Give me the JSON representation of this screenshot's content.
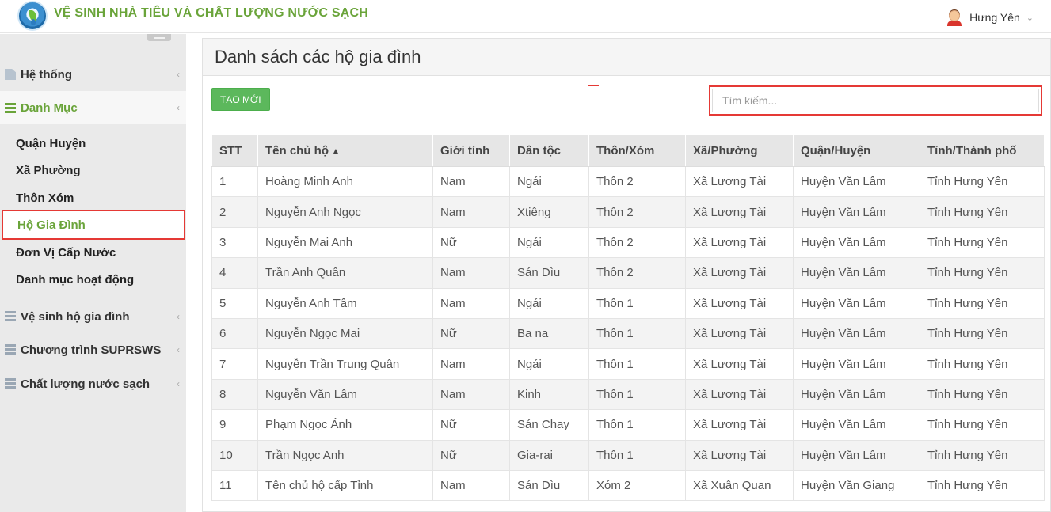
{
  "app": {
    "title": "VỆ SINH NHÀ TIÊU VÀ CHẤT LƯỢNG NƯỚC SẠCH",
    "user": "Hưng Yên"
  },
  "sidebar": {
    "groups": [
      {
        "label": "Hệ thống"
      },
      {
        "label": "Danh Mục"
      },
      {
        "label": "Vệ sinh hộ gia đình"
      },
      {
        "label": "Chương trình SUPRSWS"
      },
      {
        "label": "Chất lượng nước sạch"
      }
    ],
    "sub_items": [
      {
        "label": "Quận Huyện"
      },
      {
        "label": "Xã Phường"
      },
      {
        "label": "Thôn Xóm"
      },
      {
        "label": "Hộ Gia Đình"
      },
      {
        "label": "Đơn Vị Cấp Nước"
      },
      {
        "label": "Danh mục hoạt động"
      }
    ]
  },
  "main": {
    "title": "Danh sách các hộ gia đình",
    "create_label": "TẠO MỚI",
    "search_placeholder": "Tìm kiếm...",
    "columns": [
      "STT",
      "Tên chủ hộ",
      "Giới tính",
      "Dân tộc",
      "Thôn/Xóm",
      "Xã/Phường",
      "Quận/Huyện",
      "Tỉnh/Thành phố"
    ],
    "rows": [
      [
        "1",
        "Hoàng Minh Anh",
        "Nam",
        "Ngái",
        "Thôn 2",
        "Xã Lương Tài",
        "Huyện Văn Lâm",
        "Tỉnh Hưng Yên"
      ],
      [
        "2",
        "Nguyễn Anh Ngọc",
        "Nam",
        "Xtiêng",
        "Thôn 2",
        "Xã Lương Tài",
        "Huyện Văn Lâm",
        "Tỉnh Hưng Yên"
      ],
      [
        "3",
        "Nguyễn Mai Anh",
        "Nữ",
        "Ngái",
        "Thôn 2",
        "Xã Lương Tài",
        "Huyện Văn Lâm",
        "Tỉnh Hưng Yên"
      ],
      [
        "4",
        "Trần Anh Quân",
        "Nam",
        "Sán Dìu",
        "Thôn 2",
        "Xã Lương Tài",
        "Huyện Văn Lâm",
        "Tỉnh Hưng Yên"
      ],
      [
        "5",
        "Nguyễn Anh Tâm",
        "Nam",
        "Ngái",
        "Thôn 1",
        "Xã Lương Tài",
        "Huyện Văn Lâm",
        "Tỉnh Hưng Yên"
      ],
      [
        "6",
        "Nguyễn Ngọc Mai",
        "Nữ",
        "Ba na",
        "Thôn 1",
        "Xã Lương Tài",
        "Huyện Văn Lâm",
        "Tỉnh Hưng Yên"
      ],
      [
        "7",
        "Nguyễn Trần Trung Quân",
        "Nam",
        "Ngái",
        "Thôn 1",
        "Xã Lương Tài",
        "Huyện Văn Lâm",
        "Tỉnh Hưng Yên"
      ],
      [
        "8",
        "Nguyễn Văn Lâm",
        "Nam",
        "Kinh",
        "Thôn 1",
        "Xã Lương Tài",
        "Huyện Văn Lâm",
        "Tỉnh Hưng Yên"
      ],
      [
        "9",
        "Phạm Ngọc Ánh",
        "Nữ",
        "Sán Chay",
        "Thôn 1",
        "Xã Lương Tài",
        "Huyện Văn Lâm",
        "Tỉnh Hưng Yên"
      ],
      [
        "10",
        "Trần Ngọc Anh",
        "Nữ",
        "Gia-rai",
        "Thôn 1",
        "Xã Lương Tài",
        "Huyện Văn Lâm",
        "Tỉnh Hưng Yên"
      ],
      [
        "11",
        "Tên chủ hộ cấp Tỉnh",
        "Nam",
        "Sán Dìu",
        "Xóm 2",
        "Xã Xuân Quan",
        "Huyện Văn Giang",
        "Tỉnh Hưng Yên"
      ]
    ]
  },
  "colors": {
    "brand_green": "#6aa43a",
    "button_green": "#5cb85c",
    "highlight_red": "#e53935"
  }
}
